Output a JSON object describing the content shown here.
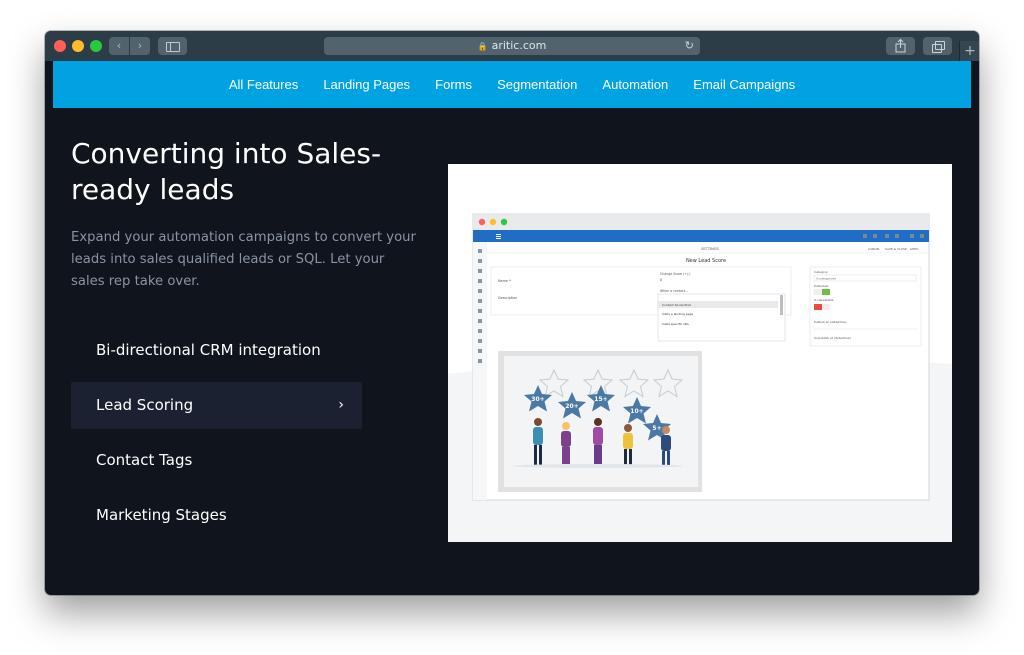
{
  "browser": {
    "url": "aritic.com"
  },
  "navbar": {
    "items": [
      "All Features",
      "Landing Pages",
      "Forms",
      "Segmentation",
      "Automation",
      "Email Campaigns"
    ]
  },
  "hero": {
    "title": "Converting into Sales-ready leads",
    "description": "Expand your automation campaigns to convert your leads into sales qualified leads or SQL. Let your sales rep take over."
  },
  "menu": {
    "items": [
      {
        "label": "Bi-directional CRM integration",
        "active": false
      },
      {
        "label": "Lead Scoring",
        "active": true
      },
      {
        "label": "Contact Tags",
        "active": false
      },
      {
        "label": "Marketing Stages",
        "active": false
      }
    ]
  },
  "preview": {
    "app_title": "New Lead Score",
    "settings_label": "SETTINGS",
    "toolbar": [
      "CANCEL",
      "SAVE & CLOSE",
      "APPLY"
    ],
    "field_name": "Name *",
    "field_description": "Description",
    "change_score_label": "Change Score (+/-)",
    "change_score_value": "0",
    "when_contact_label": "When a contact...",
    "dropdown_options": [
      "Contact Social Post",
      "Visits a landing page",
      "Visits specific URL"
    ],
    "category_label": "Category",
    "category_value": "Uncategorized",
    "published_label": "Published",
    "expiration_label": "Is repeatable",
    "publish_label": "Publish at (date/time)",
    "unpublish_label": "Unpublish at (date/time)",
    "stars": [
      "30+",
      "20+",
      "15+",
      "10+",
      "5+"
    ]
  },
  "colors": {
    "accent": "#00a2e1",
    "background": "#0f141d",
    "active_item": "#1b2130"
  }
}
